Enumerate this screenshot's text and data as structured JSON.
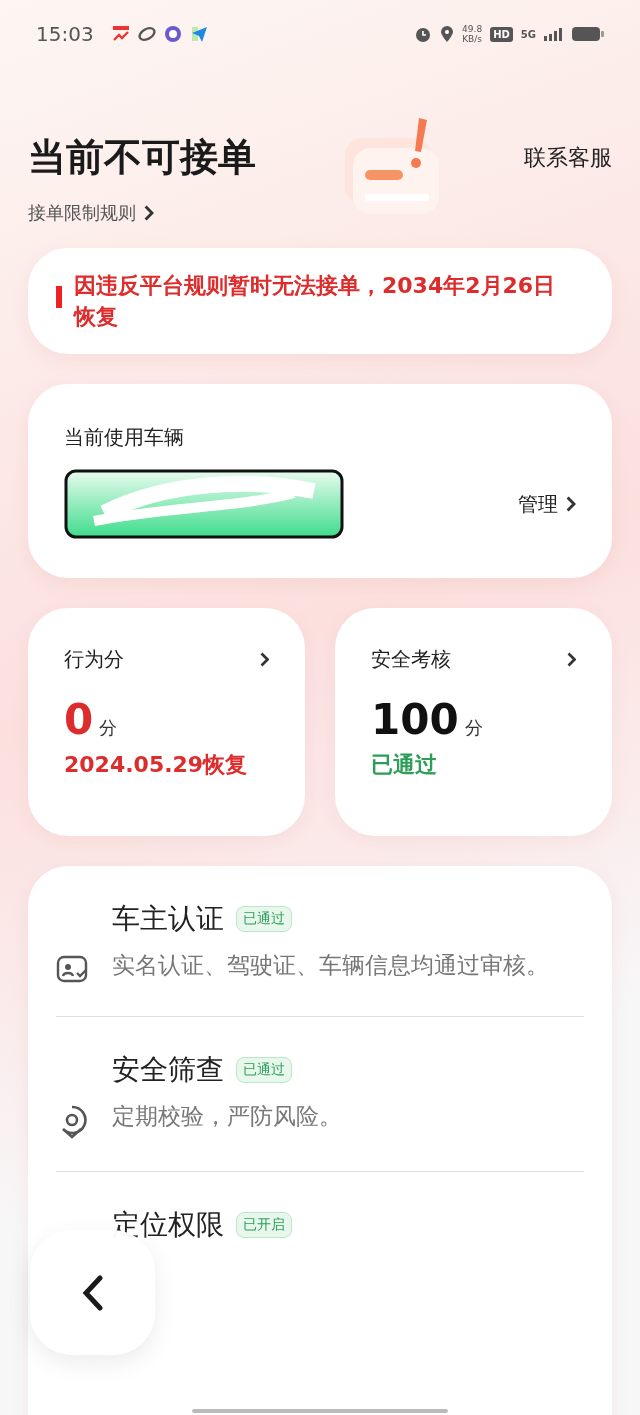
{
  "status_bar": {
    "time": "15:03",
    "speed_value": "49.8",
    "speed_unit": "KB/s",
    "hd": "HD",
    "network": "5G"
  },
  "header": {
    "title": "当前不可接单",
    "rules_link": "接单限制规则",
    "contact": "联系客服"
  },
  "alert": {
    "text": "因违反平台规则暂时无法接单，2034年2月26日恢复"
  },
  "vehicle": {
    "label": "当前使用车辆",
    "manage": "管理"
  },
  "scores": [
    {
      "title": "行为分",
      "value": "0",
      "unit": "分",
      "note": "2024.05.29恢复",
      "kind": "bad"
    },
    {
      "title": "安全考核",
      "value": "100",
      "unit": "分",
      "note": "已通过",
      "kind": "good"
    }
  ],
  "checks": [
    {
      "title": "车主认证",
      "badge": "已通过",
      "desc": "实名认证、驾驶证、车辆信息均通过审核。",
      "kind": "id"
    },
    {
      "title": "安全筛查",
      "badge": "已通过",
      "desc": "定期校验，严防风险。",
      "kind": "shield"
    },
    {
      "title": "定位权限",
      "badge": "已开启",
      "kind": "location"
    }
  ]
}
